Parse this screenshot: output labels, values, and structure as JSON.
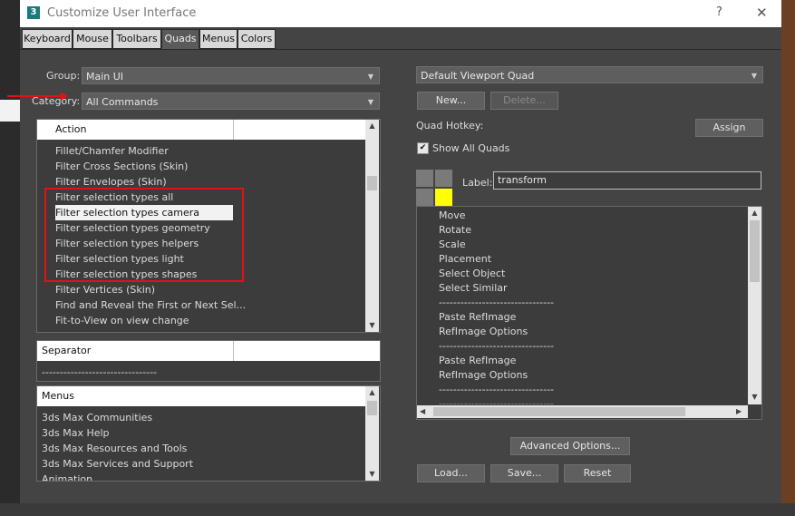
{
  "window": {
    "title": "Customize User Interface",
    "help": "?",
    "close": "✕",
    "app_icon": "3"
  },
  "tabs": [
    "Keyboard",
    "Mouse",
    "Toolbars",
    "Quads",
    "Menus",
    "Colors"
  ],
  "left": {
    "group_label": "Group:",
    "group_value": "Main UI",
    "category_label": "Category:",
    "category_value": "All Commands",
    "action_header": "Action",
    "actions": [
      "Fillet/Chamfer Modifier",
      "Filter Cross Sections (Skin)",
      "Filter Envelopes (Skin)",
      "Filter selection types all",
      "Filter selection types camera",
      "Filter selection types geometry",
      "Filter selection types helpers",
      "Filter selection types light",
      "Filter selection types shapes",
      "Filter Vertices (Skin)",
      "Find and Reveal the First or Next Sel...",
      "Fit-to-View on view change"
    ],
    "separator_header": "Separator",
    "separator_item": "--------------------------------",
    "menus_header": "Menus",
    "menus": [
      "3ds Max Communities",
      "3ds Max Help",
      "3ds Max Resources and Tools",
      "3ds Max Services and Support",
      "Animation"
    ]
  },
  "right": {
    "quad_set": "Default Viewport Quad",
    "new_label": "New...",
    "delete_label": "Delete...",
    "hotkey_label": "Quad Hotkey:",
    "assign_label": "Assign",
    "show_all_label": "Show All Quads",
    "label_label": "Label:",
    "label_value": "transform",
    "quad_items": [
      "Move",
      "Rotate",
      "Scale",
      "Placement",
      "Select Object",
      "Select Similar",
      "--------------------------------",
      "Paste RefImage",
      "RefImage Options",
      "--------------------------------",
      "Paste RefImage",
      "RefImage Options",
      "--------------------------------",
      "--------------------------------"
    ],
    "advanced_label": "Advanced Options...",
    "load_label": "Load...",
    "save_label": "Save...",
    "reset_label": "Reset"
  },
  "colors": {
    "quad_active": "#ffff00",
    "quad_inactive": "#7a7a7a",
    "highlight": "#e01212"
  }
}
